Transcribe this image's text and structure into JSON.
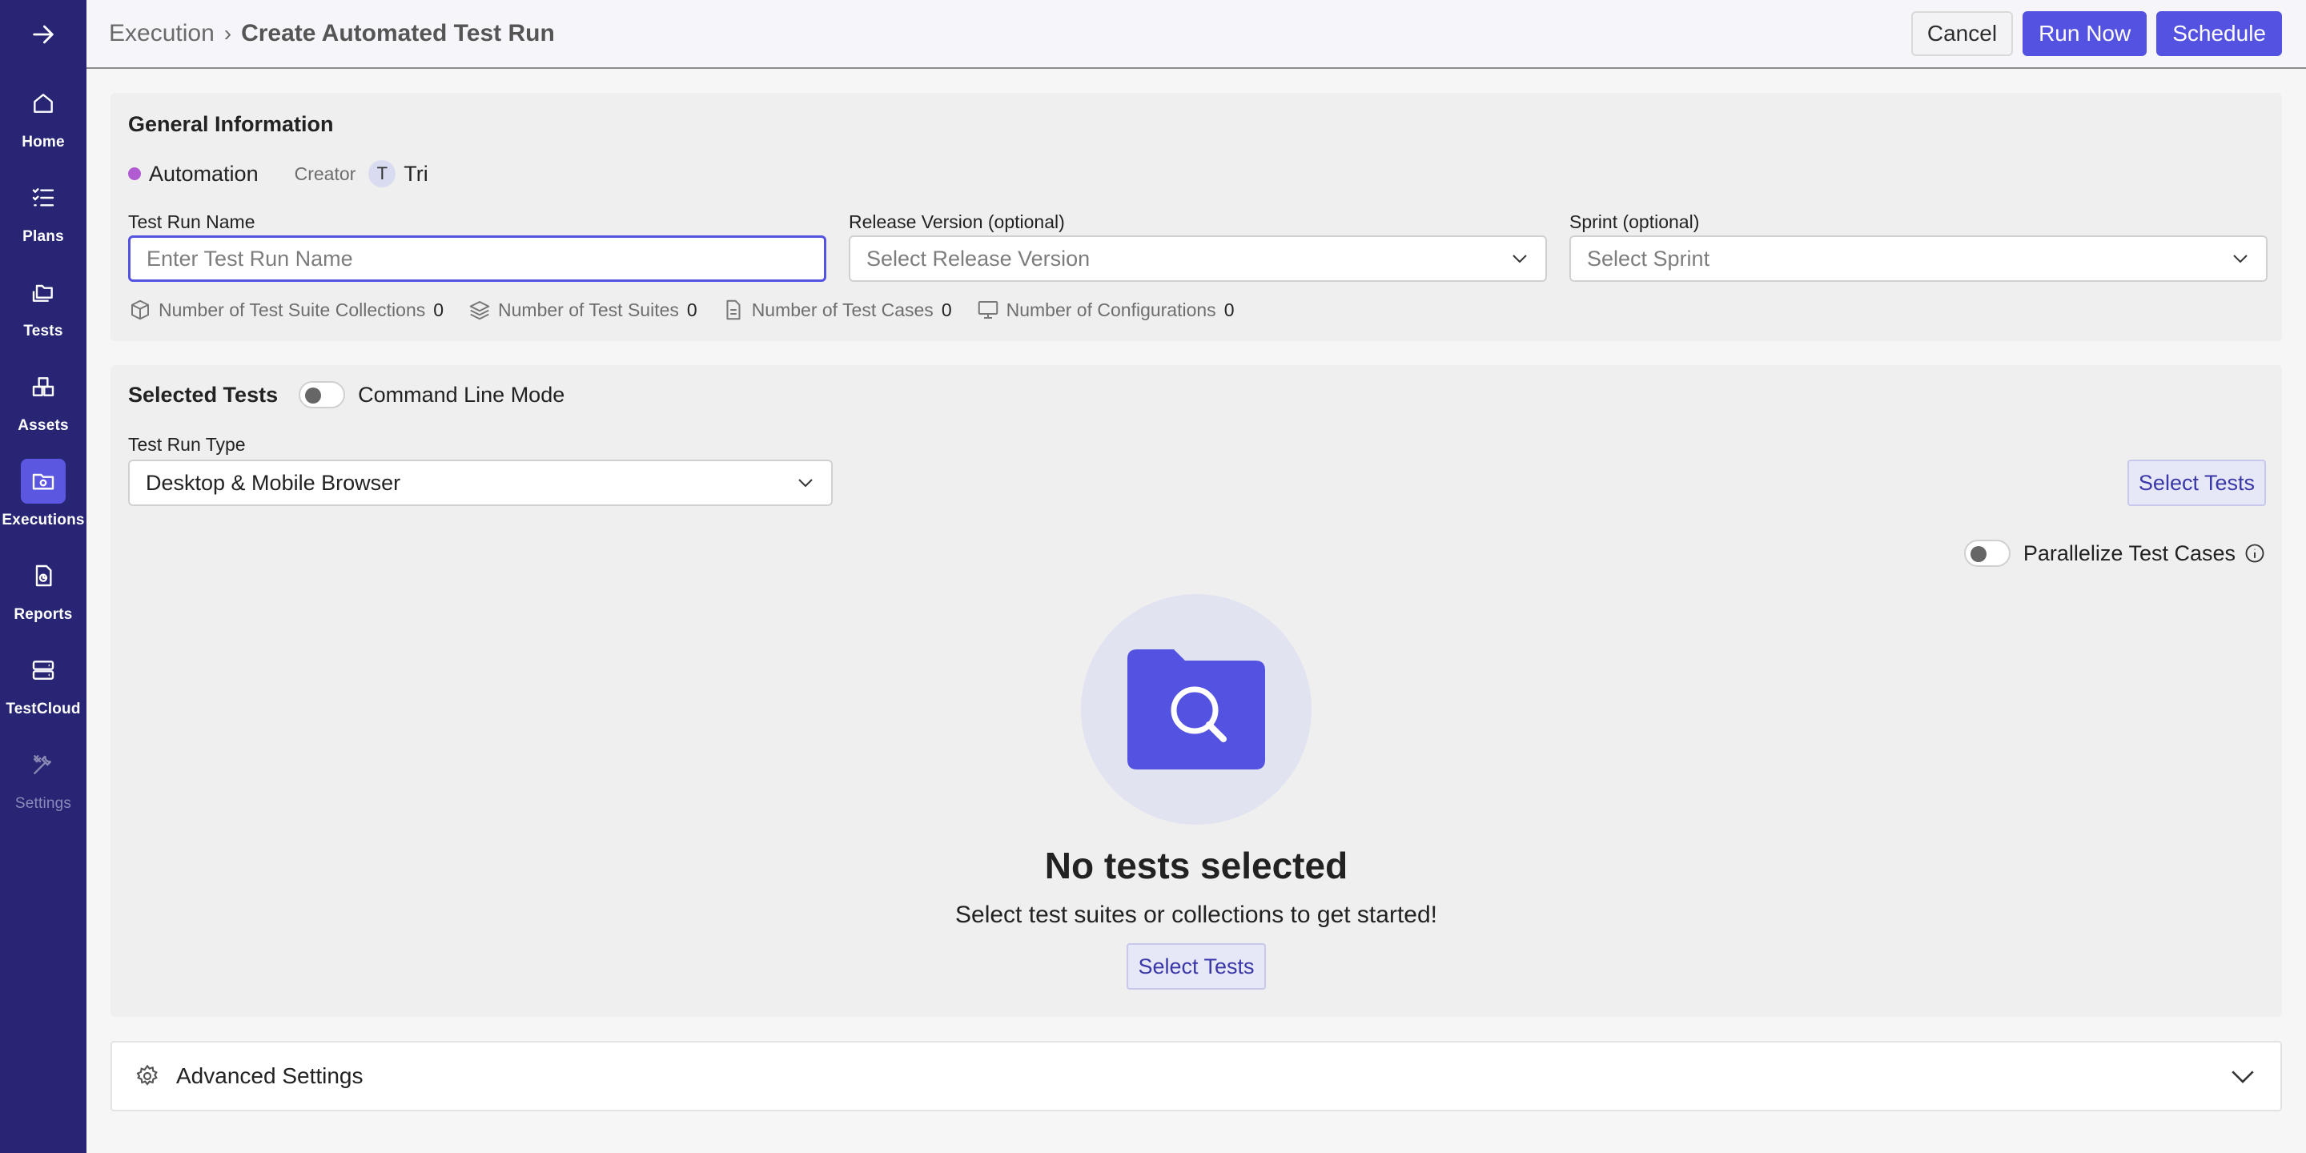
{
  "sidebar": {
    "items": [
      {
        "label": "Home",
        "icon": "home-icon"
      },
      {
        "label": "Plans",
        "icon": "list-checks-icon"
      },
      {
        "label": "Tests",
        "icon": "folders-icon"
      },
      {
        "label": "Assets",
        "icon": "boxes-icon"
      },
      {
        "label": "Executions",
        "icon": "folder-gear-icon",
        "active": true
      },
      {
        "label": "Reports",
        "icon": "report-icon"
      },
      {
        "label": "TestCloud",
        "icon": "server-icon"
      },
      {
        "label": "Settings",
        "icon": "tools-icon",
        "disabled": true
      }
    ],
    "colors": {
      "background": "#272574",
      "active": "#5b57e0"
    }
  },
  "header": {
    "breadcrumb_parent": "Execution",
    "breadcrumb_separator": "›",
    "title": "Create Automated Test Run",
    "cancel_label": "Cancel",
    "run_now_label": "Run Now",
    "schedule_label": "Schedule"
  },
  "general": {
    "title": "General Information",
    "type": "Automation",
    "creator_label": "Creator",
    "creator_initial": "T",
    "creator_name": "Tri",
    "name_label": "Test Run Name",
    "name_placeholder": "Enter Test Run Name",
    "release_label": "Release Version (optional)",
    "release_placeholder": "Select Release Version",
    "sprint_label": "Sprint (optional)",
    "sprint_placeholder": "Select Sprint",
    "counts": [
      {
        "label": "Number of Test Suite Collections",
        "value": "0"
      },
      {
        "label": "Number of Test Suites",
        "value": "0"
      },
      {
        "label": "Number of Test Cases",
        "value": "0"
      },
      {
        "label": "Number of Configurations",
        "value": "0"
      }
    ]
  },
  "tests": {
    "title": "Selected Tests",
    "command_line_label": "Command Line Mode",
    "run_type_label": "Test Run Type",
    "run_type_value": "Desktop & Mobile Browser",
    "select_tests_label": "Select Tests",
    "parallelize_label": "Parallelize Test Cases",
    "empty_title": "No tests selected",
    "empty_subtitle": "Select test suites or collections to get started!",
    "empty_button_label": "Select Tests"
  },
  "advanced": {
    "title": "Advanced Settings"
  },
  "colors": {
    "primary": "#5452e0",
    "creator_dot": "#b05bd0"
  }
}
